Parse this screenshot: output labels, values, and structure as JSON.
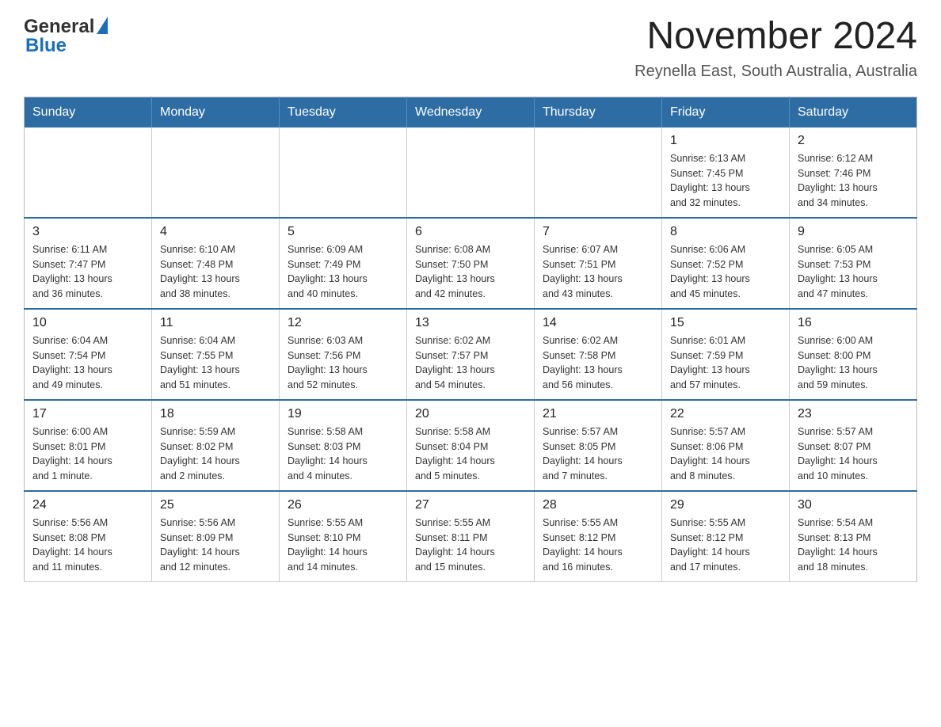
{
  "header": {
    "logo_general": "General",
    "logo_blue": "Blue",
    "title": "November 2024",
    "subtitle": "Reynella East, South Australia, Australia"
  },
  "calendar": {
    "days_of_week": [
      "Sunday",
      "Monday",
      "Tuesday",
      "Wednesday",
      "Thursday",
      "Friday",
      "Saturday"
    ],
    "weeks": [
      [
        {
          "day": "",
          "info": ""
        },
        {
          "day": "",
          "info": ""
        },
        {
          "day": "",
          "info": ""
        },
        {
          "day": "",
          "info": ""
        },
        {
          "day": "",
          "info": ""
        },
        {
          "day": "1",
          "info": "Sunrise: 6:13 AM\nSunset: 7:45 PM\nDaylight: 13 hours\nand 32 minutes."
        },
        {
          "day": "2",
          "info": "Sunrise: 6:12 AM\nSunset: 7:46 PM\nDaylight: 13 hours\nand 34 minutes."
        }
      ],
      [
        {
          "day": "3",
          "info": "Sunrise: 6:11 AM\nSunset: 7:47 PM\nDaylight: 13 hours\nand 36 minutes."
        },
        {
          "day": "4",
          "info": "Sunrise: 6:10 AM\nSunset: 7:48 PM\nDaylight: 13 hours\nand 38 minutes."
        },
        {
          "day": "5",
          "info": "Sunrise: 6:09 AM\nSunset: 7:49 PM\nDaylight: 13 hours\nand 40 minutes."
        },
        {
          "day": "6",
          "info": "Sunrise: 6:08 AM\nSunset: 7:50 PM\nDaylight: 13 hours\nand 42 minutes."
        },
        {
          "day": "7",
          "info": "Sunrise: 6:07 AM\nSunset: 7:51 PM\nDaylight: 13 hours\nand 43 minutes."
        },
        {
          "day": "8",
          "info": "Sunrise: 6:06 AM\nSunset: 7:52 PM\nDaylight: 13 hours\nand 45 minutes."
        },
        {
          "day": "9",
          "info": "Sunrise: 6:05 AM\nSunset: 7:53 PM\nDaylight: 13 hours\nand 47 minutes."
        }
      ],
      [
        {
          "day": "10",
          "info": "Sunrise: 6:04 AM\nSunset: 7:54 PM\nDaylight: 13 hours\nand 49 minutes."
        },
        {
          "day": "11",
          "info": "Sunrise: 6:04 AM\nSunset: 7:55 PM\nDaylight: 13 hours\nand 51 minutes."
        },
        {
          "day": "12",
          "info": "Sunrise: 6:03 AM\nSunset: 7:56 PM\nDaylight: 13 hours\nand 52 minutes."
        },
        {
          "day": "13",
          "info": "Sunrise: 6:02 AM\nSunset: 7:57 PM\nDaylight: 13 hours\nand 54 minutes."
        },
        {
          "day": "14",
          "info": "Sunrise: 6:02 AM\nSunset: 7:58 PM\nDaylight: 13 hours\nand 56 minutes."
        },
        {
          "day": "15",
          "info": "Sunrise: 6:01 AM\nSunset: 7:59 PM\nDaylight: 13 hours\nand 57 minutes."
        },
        {
          "day": "16",
          "info": "Sunrise: 6:00 AM\nSunset: 8:00 PM\nDaylight: 13 hours\nand 59 minutes."
        }
      ],
      [
        {
          "day": "17",
          "info": "Sunrise: 6:00 AM\nSunset: 8:01 PM\nDaylight: 14 hours\nand 1 minute."
        },
        {
          "day": "18",
          "info": "Sunrise: 5:59 AM\nSunset: 8:02 PM\nDaylight: 14 hours\nand 2 minutes."
        },
        {
          "day": "19",
          "info": "Sunrise: 5:58 AM\nSunset: 8:03 PM\nDaylight: 14 hours\nand 4 minutes."
        },
        {
          "day": "20",
          "info": "Sunrise: 5:58 AM\nSunset: 8:04 PM\nDaylight: 14 hours\nand 5 minutes."
        },
        {
          "day": "21",
          "info": "Sunrise: 5:57 AM\nSunset: 8:05 PM\nDaylight: 14 hours\nand 7 minutes."
        },
        {
          "day": "22",
          "info": "Sunrise: 5:57 AM\nSunset: 8:06 PM\nDaylight: 14 hours\nand 8 minutes."
        },
        {
          "day": "23",
          "info": "Sunrise: 5:57 AM\nSunset: 8:07 PM\nDaylight: 14 hours\nand 10 minutes."
        }
      ],
      [
        {
          "day": "24",
          "info": "Sunrise: 5:56 AM\nSunset: 8:08 PM\nDaylight: 14 hours\nand 11 minutes."
        },
        {
          "day": "25",
          "info": "Sunrise: 5:56 AM\nSunset: 8:09 PM\nDaylight: 14 hours\nand 12 minutes."
        },
        {
          "day": "26",
          "info": "Sunrise: 5:55 AM\nSunset: 8:10 PM\nDaylight: 14 hours\nand 14 minutes."
        },
        {
          "day": "27",
          "info": "Sunrise: 5:55 AM\nSunset: 8:11 PM\nDaylight: 14 hours\nand 15 minutes."
        },
        {
          "day": "28",
          "info": "Sunrise: 5:55 AM\nSunset: 8:12 PM\nDaylight: 14 hours\nand 16 minutes."
        },
        {
          "day": "29",
          "info": "Sunrise: 5:55 AM\nSunset: 8:12 PM\nDaylight: 14 hours\nand 17 minutes."
        },
        {
          "day": "30",
          "info": "Sunrise: 5:54 AM\nSunset: 8:13 PM\nDaylight: 14 hours\nand 18 minutes."
        }
      ]
    ]
  }
}
